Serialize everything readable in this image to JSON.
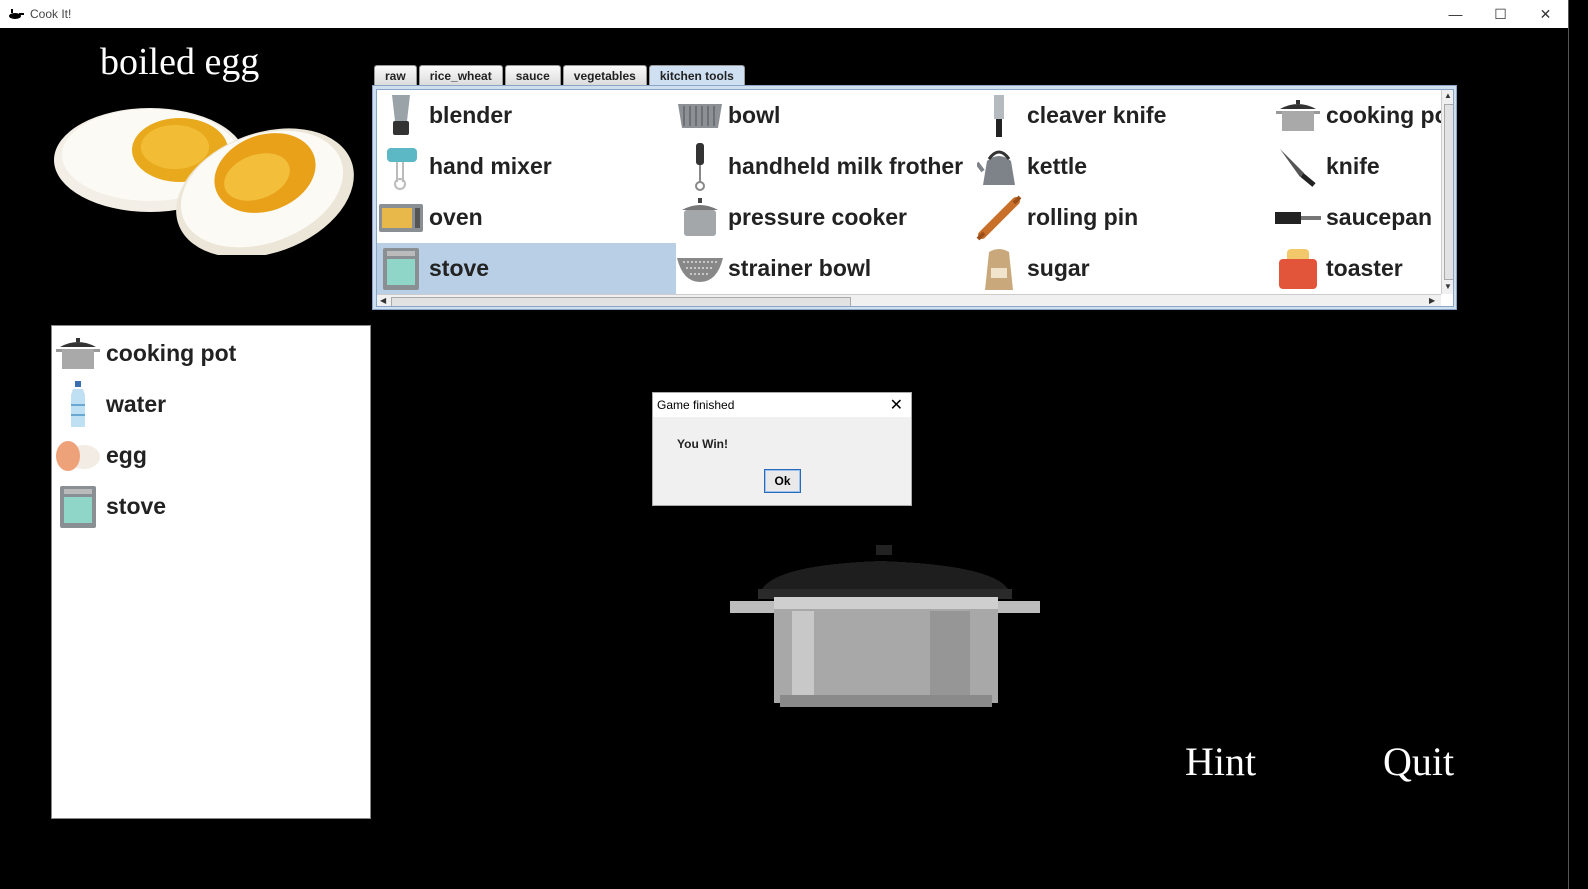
{
  "window": {
    "title": "Cook It!",
    "minimize": "—",
    "maximize": "☐",
    "close": "✕"
  },
  "recipe": {
    "title": "boiled egg"
  },
  "tabs": [
    {
      "label": "raw",
      "active": false
    },
    {
      "label": "rice_wheat",
      "active": false
    },
    {
      "label": "sauce",
      "active": false
    },
    {
      "label": "vegetables",
      "active": false
    },
    {
      "label": "kitchen tools",
      "active": true
    }
  ],
  "tools": [
    {
      "label": "blender",
      "icon": "blender-icon"
    },
    {
      "label": "bowl",
      "icon": "bowl-icon"
    },
    {
      "label": "cleaver knife",
      "icon": "cleaver-knife-icon"
    },
    {
      "label": "cooking pot",
      "icon": "cooking-pot-icon"
    },
    {
      "label": "hand mixer",
      "icon": "hand-mixer-icon"
    },
    {
      "label": "handheld milk frother",
      "icon": "milk-frother-icon"
    },
    {
      "label": "kettle",
      "icon": "kettle-icon"
    },
    {
      "label": "knife",
      "icon": "knife-icon"
    },
    {
      "label": "oven",
      "icon": "oven-icon"
    },
    {
      "label": "pressure cooker",
      "icon": "pressure-cooker-icon"
    },
    {
      "label": "rolling pin",
      "icon": "rolling-pin-icon"
    },
    {
      "label": "saucepan",
      "icon": "saucepan-icon"
    },
    {
      "label": "stove",
      "icon": "stove-icon",
      "selected": true
    },
    {
      "label": "strainer bowl",
      "icon": "strainer-bowl-icon"
    },
    {
      "label": "sugar",
      "icon": "sugar-icon"
    },
    {
      "label": "toaster",
      "icon": "toaster-icon"
    }
  ],
  "ingredients": [
    {
      "label": "cooking pot",
      "icon": "cooking-pot-icon"
    },
    {
      "label": "water",
      "icon": "water-bottle-icon"
    },
    {
      "label": "egg",
      "icon": "egg-icon"
    },
    {
      "label": "stove",
      "icon": "stove-icon"
    }
  ],
  "dialog": {
    "title": "Game finished",
    "message": "You Win!",
    "ok_label": "Ok"
  },
  "buttons": {
    "hint": "Hint",
    "quit": "Quit"
  },
  "colors": {
    "background": "#000000",
    "selection": "#b8cfe6",
    "tab_active": "#cfe0f2"
  }
}
